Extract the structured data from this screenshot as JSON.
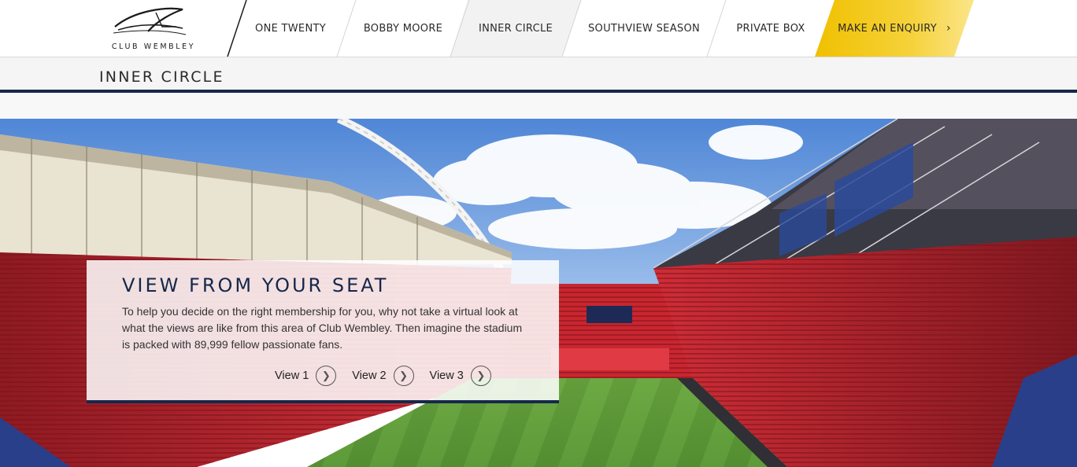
{
  "brand": {
    "logo_text": "CLUB WEMBLEY"
  },
  "nav": {
    "items": [
      {
        "label": "ONE TWENTY"
      },
      {
        "label": "BOBBY MOORE"
      },
      {
        "label": "INNER CIRCLE"
      },
      {
        "label": "SOUTHVIEW SEASON"
      },
      {
        "label": "PRIVATE BOX"
      }
    ],
    "enquiry_label": "MAKE AN ENQUIRY",
    "enquiry_icon": "chevron-right-icon",
    "active_item": "INNER CIRCLE"
  },
  "section": {
    "title": "INNER CIRCLE"
  },
  "info": {
    "heading": "VIEW FROM YOUR SEAT",
    "body": "To help you decide on the right membership for you, why not take a virtual look at what the views are like from this area of Club Wembley. Then imagine the stadium is packed with 89,999 fellow passionate fans.",
    "views": [
      {
        "label": "View 1"
      },
      {
        "label": "View 2"
      },
      {
        "label": "View 3"
      }
    ]
  },
  "colors": {
    "navy": "#15284b",
    "enquiry_yellow": "#f2c400",
    "seat_red": "#c8202a",
    "pitch_green": "#4f8a2e"
  }
}
